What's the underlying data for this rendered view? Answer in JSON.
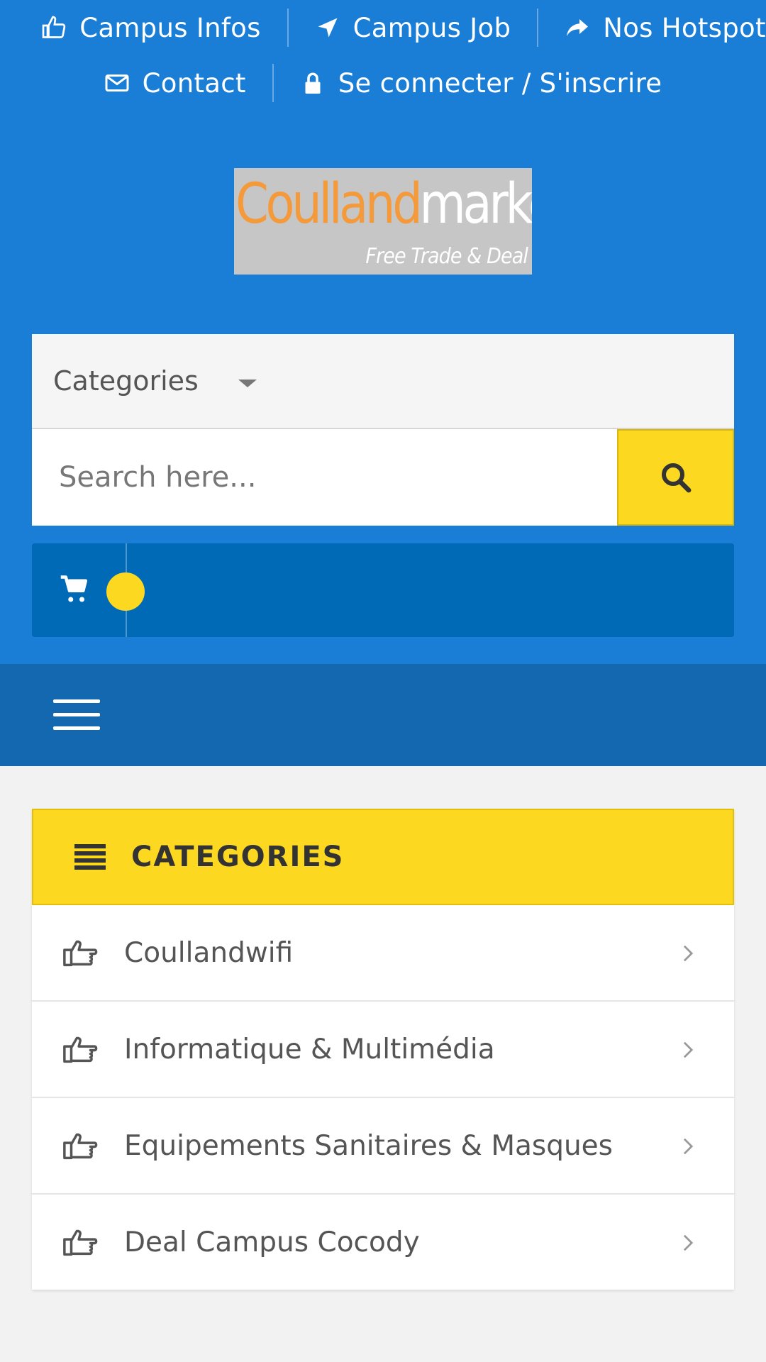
{
  "topnav": {
    "row1": [
      {
        "label": "Campus Infos",
        "icon": "thumbs-up-icon"
      },
      {
        "label": "Campus Job",
        "icon": "location-arrow-icon"
      },
      {
        "label": "Nos Hotspot",
        "icon": "share-icon"
      }
    ],
    "row2": [
      {
        "label": "Contact",
        "icon": "envelope-icon"
      },
      {
        "label": "Se connecter / S'inscrire",
        "icon": "lock-icon"
      }
    ]
  },
  "logo": {
    "part1": "Coulland",
    "part2": "market",
    "tagline": "Free Trade & Deal"
  },
  "search": {
    "category_label": "Categories",
    "placeholder": "Search here..."
  },
  "categories": {
    "heading": "CATEGORIES",
    "items": [
      {
        "label": "Coullandwifi"
      },
      {
        "label": "Informatique & Multimédia"
      },
      {
        "label": "Equipements Sanitaires & Masques"
      },
      {
        "label": "Deal Campus Cocody"
      }
    ]
  },
  "colors": {
    "primary": "#1a7dd6",
    "menubar": "#1368b0",
    "accent": "#fcd820",
    "cartbar": "#016ab6"
  }
}
